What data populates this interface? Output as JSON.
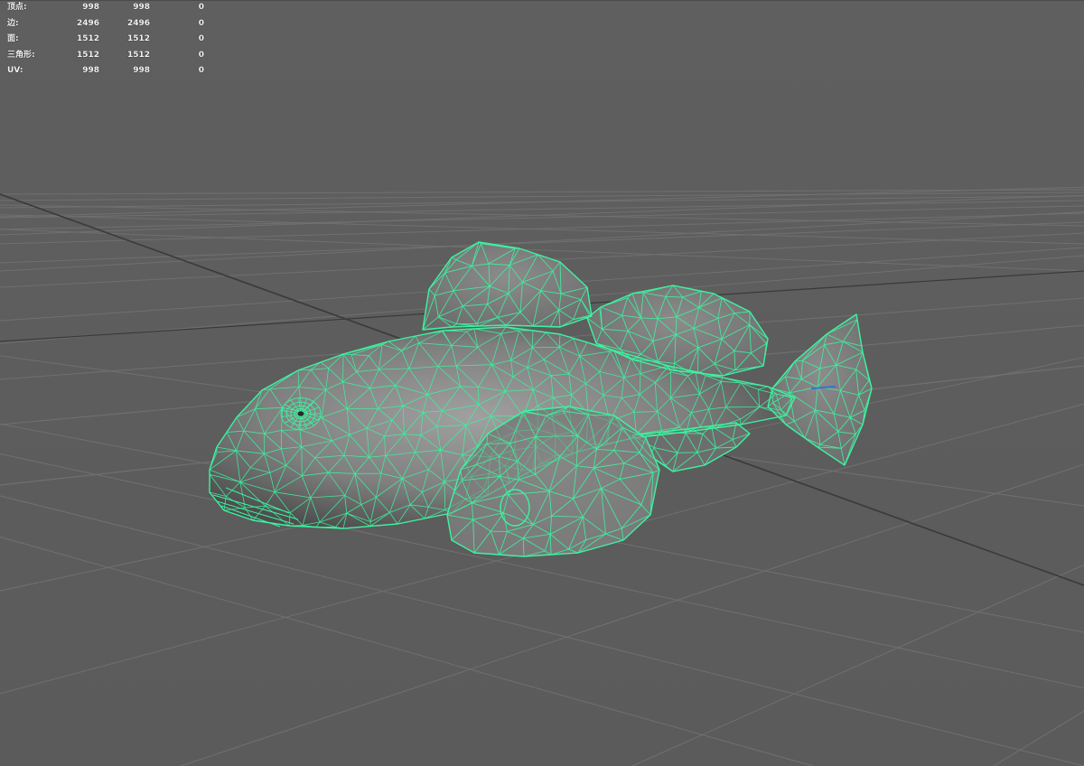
{
  "hud": {
    "rows": [
      {
        "label": "顶点:",
        "v1": "998",
        "v2": "998",
        "v3": "0"
      },
      {
        "label": "边:",
        "v1": "2496",
        "v2": "2496",
        "v3": "0"
      },
      {
        "label": "面:",
        "v1": "1512",
        "v2": "1512",
        "v3": "0"
      },
      {
        "label": "三角形:",
        "v1": "1512",
        "v2": "1512",
        "v3": "0"
      },
      {
        "label": "UV:",
        "v1": "998",
        "v2": "998",
        "v3": "0"
      }
    ]
  },
  "colors": {
    "background": "#5e5e5e",
    "grid": "#707070",
    "grid_axis": "#3a3a3a",
    "wireframe": "#3df2a0",
    "mesh_fill": "#8a8a8a"
  },
  "icons": {
    "object": "fish-wireframe-model",
    "floor": "perspective-grid"
  }
}
